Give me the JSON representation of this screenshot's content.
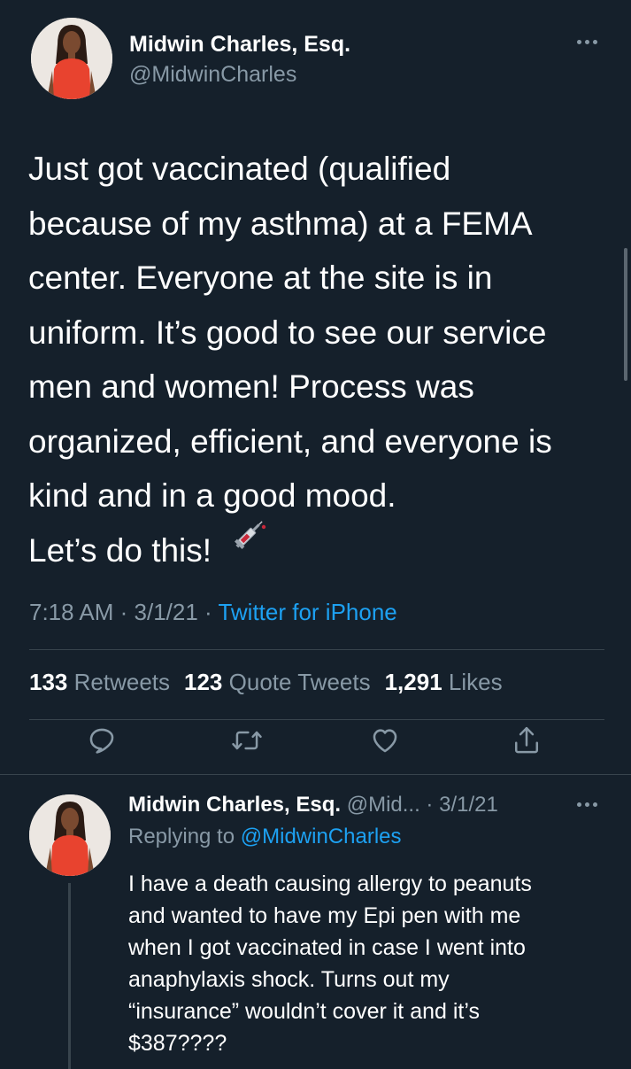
{
  "main_tweet": {
    "author_name": "Midwin Charles, Esq.",
    "author_handle": "@MidwinCharles",
    "text": "Just got vaccinated (qualified\nbecause of my asthma) at a FEMA\ncenter. Everyone at the site is in\nuniform. It’s good to see our service\nmen and women! Process was\norganized, efficient, and everyone is\nkind and in a good mood.\nLet’s do this!",
    "time": "7:18 AM",
    "date": "3/1/21",
    "separator": " · ",
    "source": "Twitter for iPhone",
    "stats": {
      "retweets_count": "133",
      "retweets_label": "Retweets",
      "quote_count": "123",
      "quote_label": "Quote Tweets",
      "likes_count": "1,291",
      "likes_label": "Likes"
    },
    "icons": {
      "emoji": "syringe-icon",
      "more": "more-icon",
      "reply": "reply-icon",
      "retweet": "retweet-icon",
      "like": "heart-icon",
      "share": "share-icon"
    }
  },
  "reply_tweet": {
    "author_name": "Midwin Charles, Esq.",
    "author_handle_truncated": "@Mid...",
    "date_sep": " · ",
    "date": "3/1/21",
    "replying_prefix": "Replying to ",
    "replying_to": "@MidwinCharles",
    "text": "I have a death causing allergy to peanuts\nand wanted to have my Epi pen with me\nwhen I got vaccinated in case I went into\nanaphylaxis shock. Turns out my\n“insurance” wouldn’t cover it and it’s\n$387????"
  },
  "colors": {
    "background": "#15202b",
    "text": "#ffffff",
    "secondary": "#8899a6",
    "link": "#1da1f2",
    "divider": "#38444d",
    "avatar_dress": "#e8432f"
  }
}
